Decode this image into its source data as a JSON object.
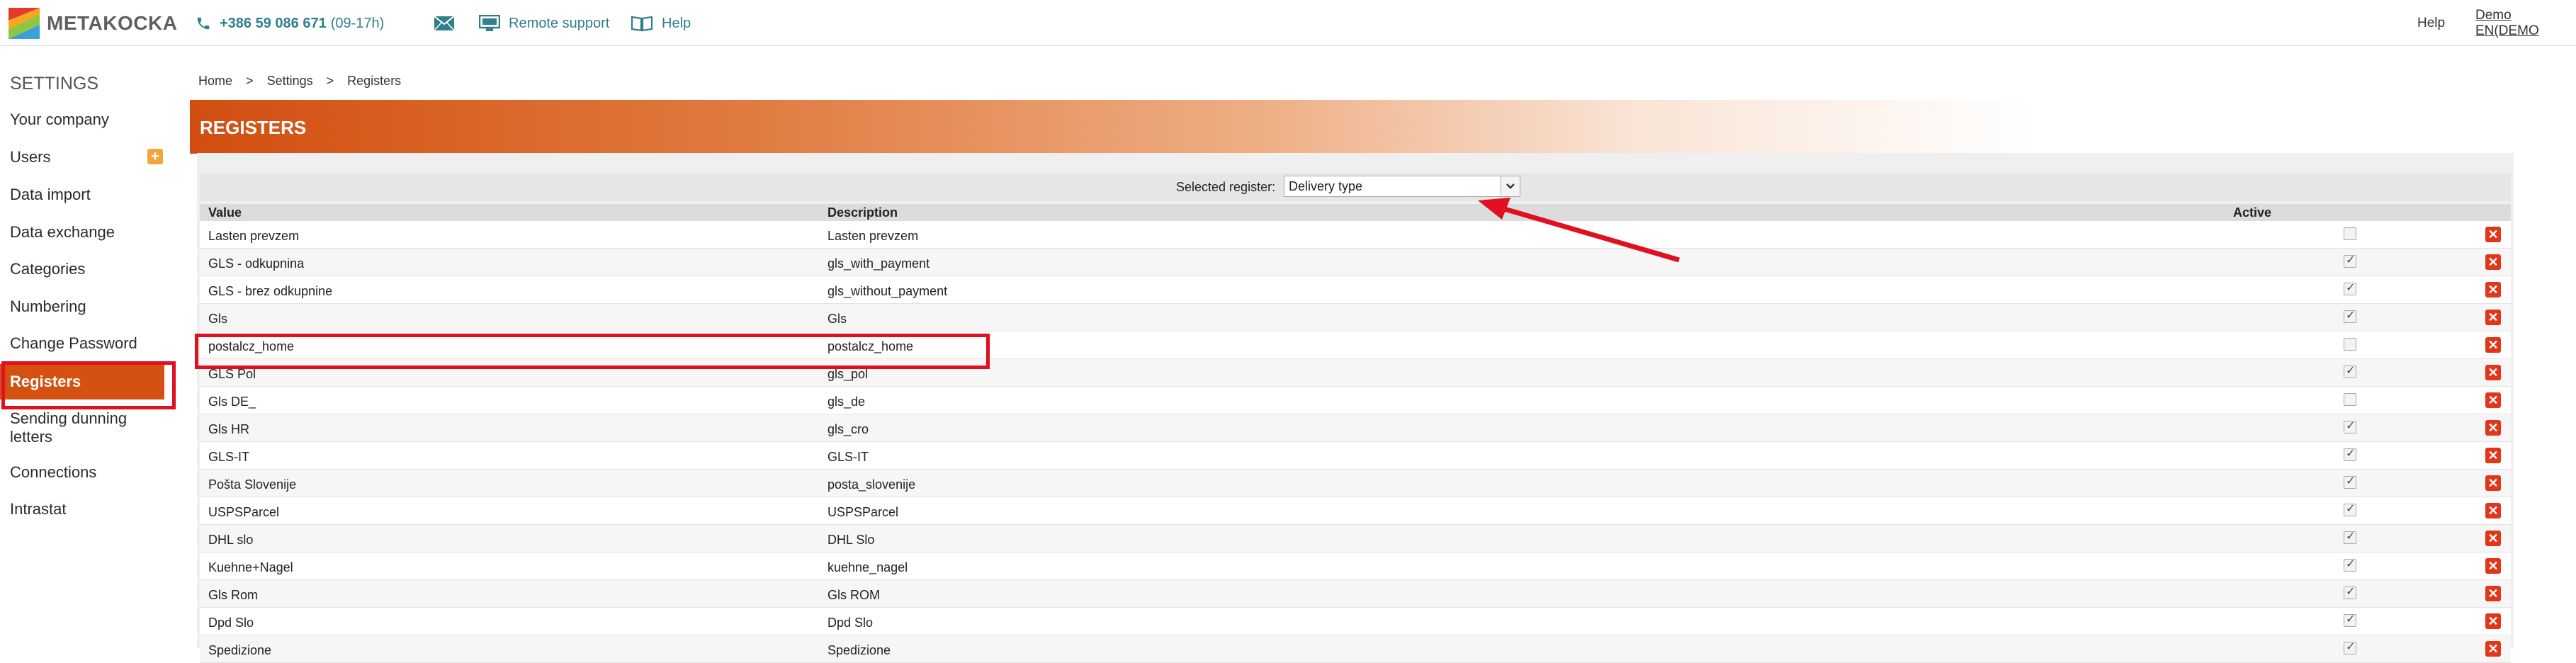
{
  "header": {
    "logo_text": "METAKOCKA",
    "phone": "+386 59 086 671",
    "phone_hours": "(09-17h)",
    "remote_support": "Remote support",
    "help": "Help",
    "right_help": "Help",
    "user": "Demo EN(DEMO",
    "accent_color": "#2f7f8c"
  },
  "sidebar": {
    "title": "SETTINGS",
    "items": [
      {
        "label": "Your company"
      },
      {
        "label": "Users"
      },
      {
        "label": "Data import"
      },
      {
        "label": "Data exchange"
      },
      {
        "label": "Categories"
      },
      {
        "label": "Numbering"
      },
      {
        "label": "Change Password"
      },
      {
        "label": "Registers"
      },
      {
        "label": "Sending dunning letters"
      },
      {
        "label": "Connections"
      },
      {
        "label": "Intrastat"
      }
    ],
    "active_color": "#d45112"
  },
  "breadcrumb": {
    "home": "Home",
    "sep1": ">",
    "settings": "Settings",
    "sep2": ">",
    "current": "Registers"
  },
  "banner": {
    "title": "REGISTERS"
  },
  "selector": {
    "label": "Selected register:",
    "value": "Delivery type"
  },
  "table": {
    "headers": {
      "value": "Value",
      "description": "Description",
      "active": "Active"
    },
    "rows": [
      {
        "value": "Lasten prevzem",
        "description": "Lasten prevzem",
        "active": false
      },
      {
        "value": "GLS - odkupnina",
        "description": "gls_with_payment",
        "active": true
      },
      {
        "value": "GLS - brez odkupnine",
        "description": "gls_without_payment",
        "active": true
      },
      {
        "value": "Gls",
        "description": "Gls",
        "active": true
      },
      {
        "value": "postalcz_home",
        "description": "postalcz_home",
        "active": false
      },
      {
        "value": "GLS Pol",
        "description": "gls_pol",
        "active": true
      },
      {
        "value": "Gls DE_",
        "description": "gls_de",
        "active": false
      },
      {
        "value": "Gls HR",
        "description": "gls_cro",
        "active": true
      },
      {
        "value": "GLS-IT",
        "description": "GLS-IT",
        "active": true
      },
      {
        "value": "Pošta Slovenije",
        "description": "posta_slovenije",
        "active": true
      },
      {
        "value": "USPSParcel",
        "description": "USPSParcel",
        "active": true
      },
      {
        "value": "DHL slo",
        "description": "DHL Slo",
        "active": true
      },
      {
        "value": "Kuehne+Nagel",
        "description": "kuehne_nagel",
        "active": true
      },
      {
        "value": "Gls Rom",
        "description": "Gls ROM",
        "active": true
      },
      {
        "value": "Dpd Slo",
        "description": "Dpd Slo",
        "active": true
      },
      {
        "value": "Spedizione",
        "description": "Spedizione",
        "active": true
      }
    ]
  },
  "annotation_color": "#e01020"
}
